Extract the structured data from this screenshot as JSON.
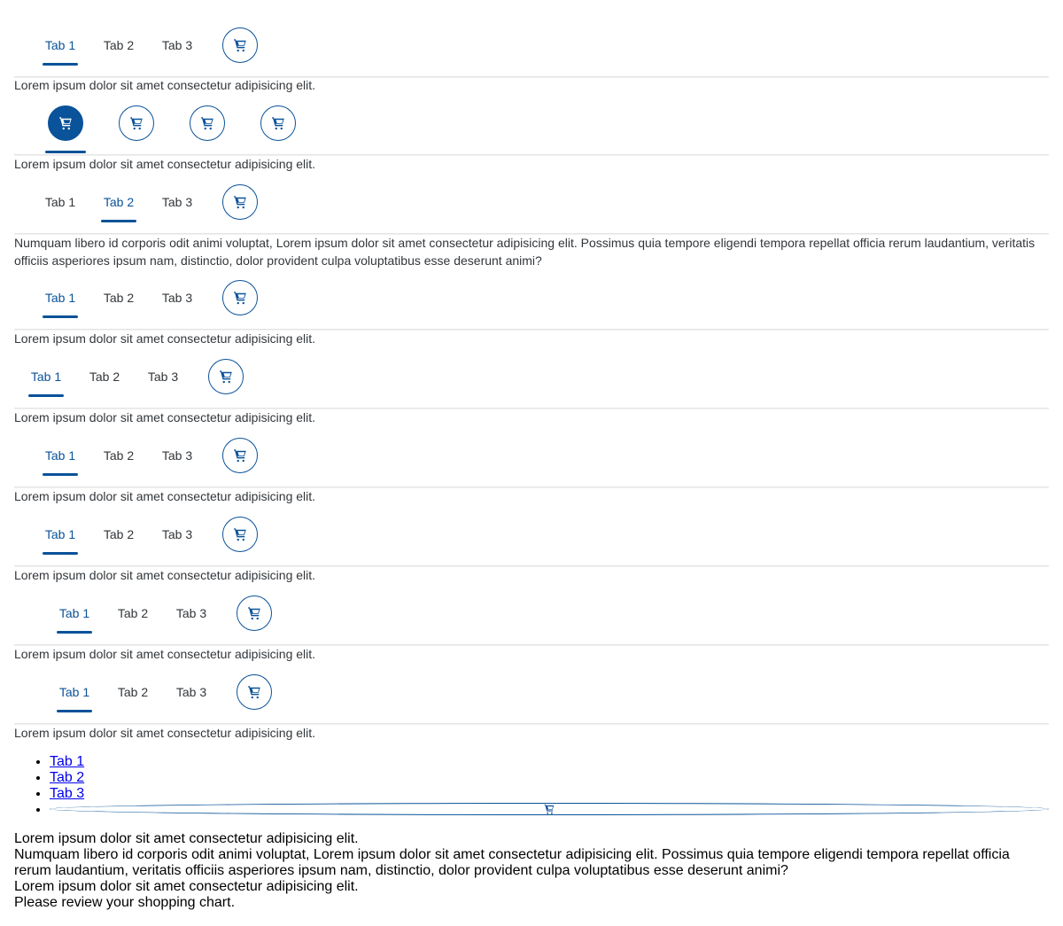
{
  "tabs": [
    "Tab 1",
    "Tab 2",
    "Tab 3"
  ],
  "lorem_short": "Lorem ipsum dolor sit amet consectetur adipisicing elit.",
  "lorem_long": "Numquam libero id corporis odit animi voluptat, Lorem ipsum dolor sit amet consectetur adipisicing elit. Possimus quia tempore eligendi tempora repellat officia rerum laudantium, veritatis officiis asperiores ipsum nam, distinctio, dolor provident culpa voluptatibus esse deserunt animi?",
  "review_text": "Please review your shopping chart.",
  "cart_icon": "shopping-cart-icon",
  "accent_color": "#0a5299",
  "plain_list": {
    "links": [
      "Tab 1",
      "Tab 2",
      "Tab 3"
    ]
  }
}
